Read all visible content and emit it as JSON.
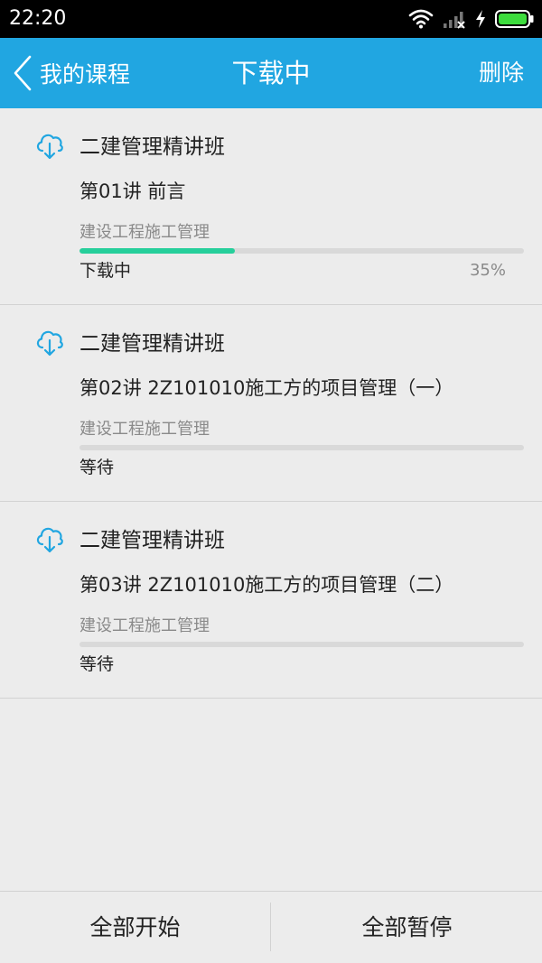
{
  "status_bar": {
    "time": "22:20",
    "icons": [
      "wifi-icon",
      "signal-icon",
      "charging-icon",
      "battery-icon"
    ]
  },
  "nav": {
    "back_label": "我的课程",
    "title": "下载中",
    "delete_label": "删除",
    "bg_color": "#21a6e1"
  },
  "downloads": [
    {
      "course": "二建管理精讲班",
      "lesson": "第01讲 前言",
      "subject": "建设工程施工管理",
      "progress": 0.35,
      "status": "下载中",
      "percent": "35%"
    },
    {
      "course": "二建管理精讲班",
      "lesson": "第02讲 2Z101010施工方的项目管理（一）",
      "subject": "建设工程施工管理",
      "progress": 0,
      "status": "等待",
      "percent": ""
    },
    {
      "course": "二建管理精讲班",
      "lesson": "第03讲 2Z101010施工方的项目管理（二）",
      "subject": "建设工程施工管理",
      "progress": 0,
      "status": "等待",
      "percent": ""
    }
  ],
  "colors": {
    "progress_fill": "#26cf9b",
    "progress_track": "#d9d9d9",
    "icon": "#21a6e1"
  },
  "bottom": {
    "start_all_label": "全部开始",
    "pause_all_label": "全部暂停"
  }
}
